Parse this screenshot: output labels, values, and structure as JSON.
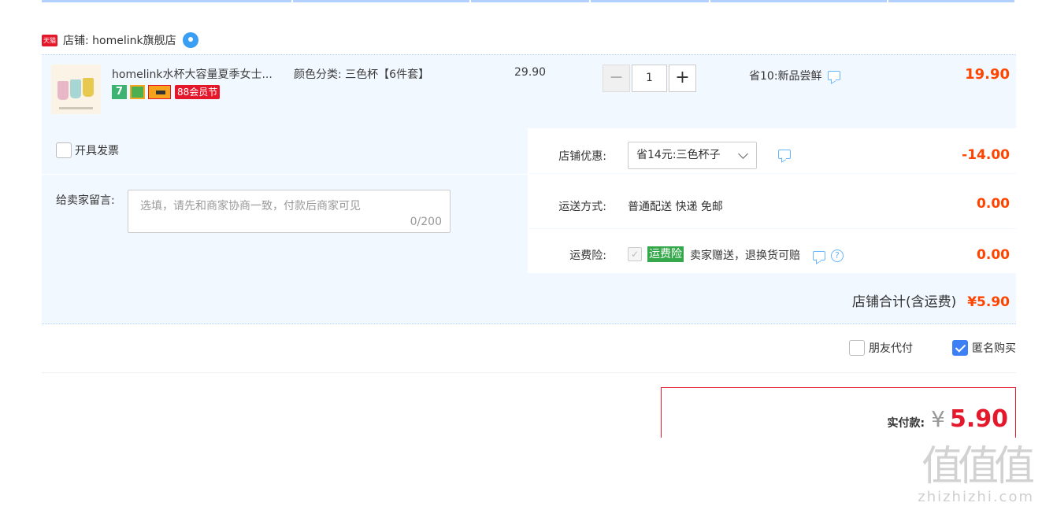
{
  "shop": {
    "platform_badge": "天猫",
    "label": "店铺: homelink旗舰店"
  },
  "item": {
    "title": "homelink水杯大容量夏季女士...",
    "sku": "颜色分类: 三色杯【6件套】",
    "unit_price": "29.90",
    "quantity": "1",
    "qty_minus": "−",
    "qty_plus": "+",
    "promo": "省10:新品尝鲜",
    "total": "19.90",
    "badges": {
      "seven_day": "7",
      "member_festival": "88会员节"
    }
  },
  "options": {
    "invoice_label": "开具发票",
    "message_label": "给卖家留言:",
    "message_placeholder": "选填，请先和商家协商一致，付款后商家可见",
    "message_count": "0/200"
  },
  "discount": {
    "label": "店铺优惠:",
    "selected": "省14元:三色杯子",
    "amount": "-14.00"
  },
  "shipping": {
    "label": "运送方式:",
    "value": "普通配送 快递 免邮",
    "amount": "0.00"
  },
  "insurance": {
    "label": "运费险:",
    "badge": "运费险",
    "text": "卖家赠送，退换货可赔",
    "help": "?",
    "amount": "0.00"
  },
  "shop_total": {
    "label": "店铺合计(含运费)",
    "amount": "¥5.90"
  },
  "pay_options": {
    "friend_pay": "朋友代付",
    "anonymous": "匿名购买"
  },
  "payment": {
    "label": "实付款:",
    "currency": "¥",
    "amount": "5.90"
  },
  "watermark": {
    "glyphs": "值值值",
    "site": "zhizhizhi.com"
  },
  "colors": {
    "accent_red": "#e5172b",
    "price_orange": "#ff4400",
    "light_blue_bg": "#f2f8ff",
    "checkbox_blue": "#3d7ff5",
    "insurance_green": "#36a84c"
  }
}
